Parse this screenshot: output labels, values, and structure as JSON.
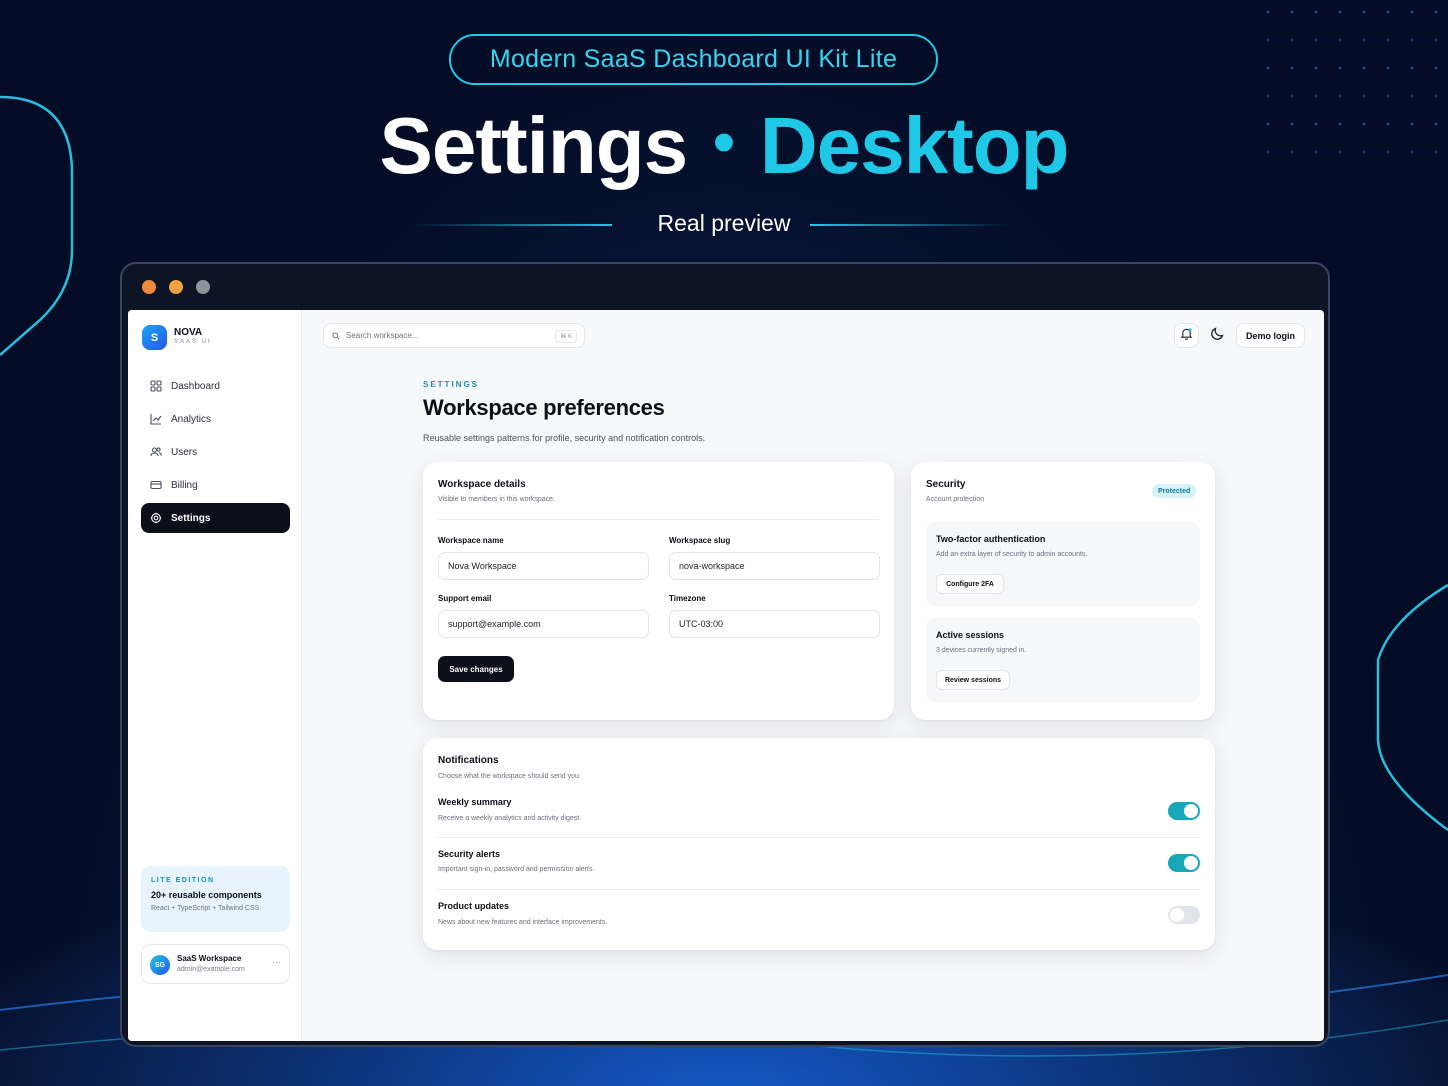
{
  "hero": {
    "pill": "Modern SaaS Dashboard UI Kit Lite",
    "title_left": "Settings",
    "title_sep": "•",
    "title_right": "Desktop",
    "subtitle": "Real preview"
  },
  "brand": {
    "mark": "S",
    "name": "NOVA",
    "sub": "SAAS UI"
  },
  "nav": [
    {
      "label": "Dashboard",
      "icon": "grid-icon",
      "active": false
    },
    {
      "label": "Analytics",
      "icon": "chart-line-icon",
      "active": false
    },
    {
      "label": "Users",
      "icon": "users-icon",
      "active": false
    },
    {
      "label": "Billing",
      "icon": "credit-card-icon",
      "active": false
    },
    {
      "label": "Settings",
      "icon": "gear-icon",
      "active": true
    }
  ],
  "edition": {
    "kicker": "LITE EDITION",
    "title": "20+ reusable components",
    "sub": "React + TypeScript + Tailwind CSS."
  },
  "account": {
    "initials": "SG",
    "name": "SaaS Workspace",
    "email": "admin@example.com",
    "more": "···"
  },
  "topbar": {
    "search_placeholder": "Search workspace...",
    "shortcut": "⌘ K",
    "demo_login": "Demo login"
  },
  "page": {
    "eyebrow": "SETTINGS",
    "title": "Workspace preferences",
    "description": "Reusable settings patterns for profile, security and notification controls."
  },
  "workspace_card": {
    "title": "Workspace details",
    "sub": "Visible to members in this workspace.",
    "fields": {
      "name_label": "Workspace name",
      "name_value": "Nova Workspace",
      "slug_label": "Workspace slug",
      "slug_value": "nova-workspace",
      "email_label": "Support email",
      "email_value": "support@example.com",
      "tz_label": "Timezone",
      "tz_value": "UTC-03:00"
    },
    "save_label": "Save changes"
  },
  "security_card": {
    "title": "Security",
    "sub": "Account protection",
    "badge": "Protected",
    "twofa": {
      "title": "Two-factor authentication",
      "desc": "Add an extra layer of security to admin accounts.",
      "button": "Configure 2FA"
    },
    "sessions": {
      "title": "Active sessions",
      "desc": "3 devices currently signed in.",
      "button": "Review sessions"
    }
  },
  "notifications": {
    "title": "Notifications",
    "sub": "Choose what the workspace should send you.",
    "rows": [
      {
        "title": "Weekly summary",
        "desc": "Receive a weekly analytics and activity digest.",
        "on": true
      },
      {
        "title": "Security alerts",
        "desc": "Important sign-in, password and permission alerts.",
        "on": true
      },
      {
        "title": "Product updates",
        "desc": "News about new features and interface improvements.",
        "on": false
      }
    ]
  },
  "colors": {
    "accent": "#1ec8e6",
    "toggle_on": "#16a8b8",
    "dark": "#0b0f19",
    "background": "#050d26"
  }
}
